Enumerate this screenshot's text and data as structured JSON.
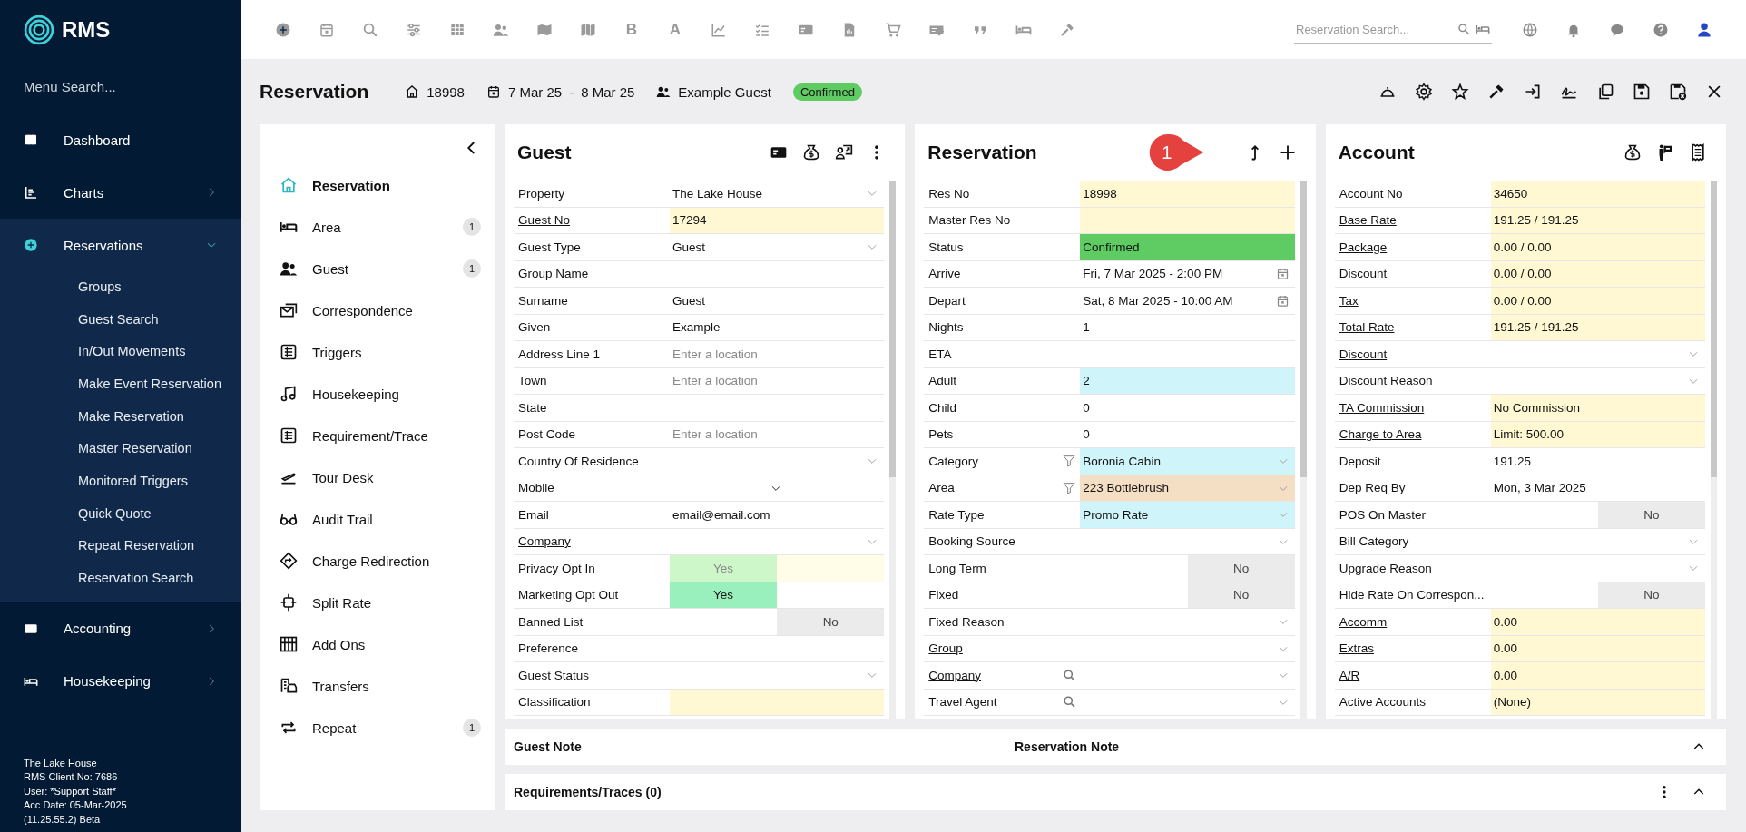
{
  "sidebar": {
    "logo": "RMS",
    "menu_search": {
      "placeholder": "Menu Search..."
    },
    "items": [
      {
        "label": "Dashboard",
        "selected": false
      },
      {
        "label": "Charts",
        "expanded": false,
        "selected": false
      },
      {
        "label": "Reservations",
        "expanded": true,
        "selected": true,
        "children": [
          {
            "label": "Groups"
          },
          {
            "label": "Guest Search"
          },
          {
            "label": "In/Out Movements"
          },
          {
            "label": "Make Event Reservation"
          },
          {
            "label": "Make Reservation"
          },
          {
            "label": "Master Reservation"
          },
          {
            "label": "Monitored Triggers"
          },
          {
            "label": "Quick Quote"
          },
          {
            "label": "Repeat Reservation"
          },
          {
            "label": "Reservation Search"
          }
        ]
      },
      {
        "label": "Accounting",
        "expanded": false,
        "selected": false
      },
      {
        "label": "Housekeeping",
        "expanded": false,
        "selected": false
      }
    ],
    "footer": [
      "The Lake House",
      "RMS Client No: 7686",
      "User: *Support Staff*",
      "Acc Date: 05-Mar-2025",
      "(11.25.55.2)  Beta"
    ]
  },
  "toolbar": {
    "letters": [
      "B",
      "A"
    ],
    "search": {
      "placeholder": "Reservation Search..."
    }
  },
  "header": {
    "title": "Reservation",
    "res_no": "18998",
    "arrive": "7 Mar 25",
    "separator": "-",
    "depart": "8 Mar 25",
    "guest": "Example Guest",
    "status": "Confirmed"
  },
  "nav": [
    {
      "label": "Reservation",
      "selected": true
    },
    {
      "label": "Area",
      "selected": false,
      "count": "1"
    },
    {
      "label": "Guest",
      "selected": false,
      "count": "1"
    },
    {
      "label": "Correspondence",
      "selected": false
    },
    {
      "label": "Triggers",
      "selected": false
    },
    {
      "label": "Housekeeping",
      "selected": false
    },
    {
      "label": "Requirement/Trace",
      "selected": false
    },
    {
      "label": "Tour Desk",
      "selected": false
    },
    {
      "label": "Audit Trail",
      "selected": false
    },
    {
      "label": "Charge Redirection",
      "selected": false
    },
    {
      "label": "Split Rate",
      "selected": false
    },
    {
      "label": "Add Ons",
      "selected": false
    },
    {
      "label": "Transfers",
      "selected": false
    },
    {
      "label": "Repeat",
      "selected": false,
      "count": "1"
    }
  ],
  "panels": [
    {
      "title": "Guest",
      "kind": "guest",
      "rows": [
        {
          "label": "Property",
          "kind": "select",
          "value": "The Lake House"
        },
        {
          "label": "Guest No",
          "link": true,
          "kind": "text",
          "value": "17294",
          "color": "#fff8d2"
        },
        {
          "label": "Guest Type",
          "kind": "select",
          "value": "Guest"
        },
        {
          "label": "Group Name",
          "kind": "text"
        },
        {
          "label": "Surname",
          "kind": "text",
          "value": "Guest"
        },
        {
          "label": "Given",
          "kind": "text",
          "value": "Example"
        },
        {
          "label": "Address Line 1",
          "kind": "text",
          "placeholder": "Enter a location"
        },
        {
          "label": "Town",
          "kind": "text",
          "placeholder": "Enter a location"
        },
        {
          "label": "State",
          "kind": "text"
        },
        {
          "label": "Post Code",
          "kind": "text",
          "placeholder": "Enter a location"
        },
        {
          "label": "Country Of Residence",
          "kind": "select"
        },
        {
          "label": "Mobile",
          "kind": "phone"
        },
        {
          "label": "Email",
          "kind": "text",
          "value": "email@email.com"
        },
        {
          "label": "Company",
          "link": true,
          "kind": "select"
        },
        {
          "label": "Privacy Opt In",
          "kind": "toggle",
          "value": "Yes",
          "on": true,
          "disabled": true
        },
        {
          "label": "Marketing Opt Out",
          "kind": "toggle",
          "value": "Yes",
          "on": true
        },
        {
          "label": "Banned List",
          "kind": "toggle",
          "value": "No",
          "on": false
        },
        {
          "label": "Preference",
          "kind": "text"
        },
        {
          "label": "Guest Status",
          "kind": "select"
        },
        {
          "label": "Classification",
          "kind": "text",
          "color": "#fff8d2"
        }
      ]
    },
    {
      "title": "Reservation",
      "kind": "reservation",
      "callout": "1",
      "rows": [
        {
          "label": "Res No",
          "kind": "text",
          "value": "18998",
          "color": "#fff8d2"
        },
        {
          "label": "Master Res No",
          "kind": "text",
          "color": "#fff8d2"
        },
        {
          "label": "Status",
          "kind": "text",
          "value": "Confirmed",
          "color": "#5fcc63"
        },
        {
          "label": "Arrive",
          "kind": "date",
          "value": "Fri, 7 Mar 2025 - 2:00 PM"
        },
        {
          "label": "Depart",
          "kind": "date",
          "value": "Sat, 8 Mar 2025 - 10:00 AM"
        },
        {
          "label": "Nights",
          "kind": "text",
          "value": "1"
        },
        {
          "label": "ETA",
          "kind": "text"
        },
        {
          "label": "Adult",
          "kind": "text",
          "value": "2",
          "color": "#cff4fa"
        },
        {
          "label": "Child",
          "kind": "text",
          "value": "0"
        },
        {
          "label": "Pets",
          "kind": "text",
          "value": "0"
        },
        {
          "label": "Category",
          "kind": "select",
          "filter_button": true,
          "value": "Boronia Cabin",
          "color": "#cff4fa"
        },
        {
          "label": "Area",
          "kind": "select",
          "filter_button": true,
          "value": "223 Bottlebrush",
          "color": "#f5dfc4"
        },
        {
          "label": "Rate Type",
          "kind": "select",
          "value": "Promo Rate",
          "color": "#cff4fa"
        },
        {
          "label": "Booking Source",
          "kind": "select"
        },
        {
          "label": "Long Term",
          "kind": "toggle",
          "value": "No",
          "on": false
        },
        {
          "label": "Fixed",
          "kind": "toggle",
          "value": "No",
          "on": false
        },
        {
          "label": "Fixed Reason",
          "kind": "select"
        },
        {
          "label": "Group",
          "link": true,
          "kind": "select"
        },
        {
          "label": "Company",
          "link": true,
          "kind": "select",
          "search_button": true
        },
        {
          "label": "Travel Agent",
          "kind": "select",
          "search_button": true
        }
      ]
    },
    {
      "title": "Account",
      "kind": "account",
      "rows": [
        {
          "label": "Account No",
          "kind": "text",
          "value": "34650",
          "color": "#fff8d2"
        },
        {
          "label": "Base Rate",
          "link": true,
          "kind": "text",
          "value": "191.25 / 191.25",
          "color": "#fff8d2"
        },
        {
          "label": "Package",
          "link": true,
          "kind": "text",
          "value": "0.00 / 0.00",
          "color": "#fff8d2"
        },
        {
          "label": "Discount",
          "kind": "text",
          "value": "0.00 / 0.00",
          "color": "#fff8d2"
        },
        {
          "label": "Tax",
          "link": true,
          "kind": "text",
          "value": "0.00 / 0.00",
          "color": "#fff8d2"
        },
        {
          "label": "Total Rate",
          "link": true,
          "kind": "text",
          "value": "191.25 / 191.25",
          "color": "#fff8d2"
        },
        {
          "label": "Discount",
          "link": true,
          "kind": "select"
        },
        {
          "label": "Discount Reason",
          "kind": "select"
        },
        {
          "label": "TA Commission",
          "link": true,
          "kind": "text",
          "value": "No Commission",
          "color": "#fff8d2"
        },
        {
          "label": "Charge to Area",
          "link": true,
          "kind": "text",
          "value": "Limit: 500.00",
          "color": "#fff8d2"
        },
        {
          "label": "Deposit",
          "kind": "text",
          "value": "191.25"
        },
        {
          "label": "Dep Req By",
          "kind": "text",
          "value": "Mon, 3 Mar 2025"
        },
        {
          "label": "POS On Master",
          "kind": "toggle",
          "value": "No",
          "on": false
        },
        {
          "label": "Bill Category",
          "kind": "select"
        },
        {
          "label": "Upgrade Reason",
          "kind": "select"
        },
        {
          "label": "Hide Rate On Correspon...",
          "kind": "toggle",
          "value": "No",
          "on": false
        },
        {
          "label": "Accomm",
          "link": true,
          "kind": "text",
          "value": "0.00",
          "color": "#fff8d2"
        },
        {
          "label": "Extras",
          "link": true,
          "kind": "text",
          "value": "0.00",
          "color": "#fff8d2"
        },
        {
          "label": "A/R",
          "link": true,
          "kind": "text",
          "value": "0.00",
          "color": "#fff8d2"
        },
        {
          "label": "Active Accounts",
          "kind": "text",
          "value": "(None)",
          "color": "#fff8d2"
        }
      ]
    }
  ],
  "notes": {
    "guest_note": "Guest Note",
    "reservation_note": "Reservation Note",
    "expanded": true
  },
  "requirements": {
    "title": "Requirements/Traces (0)",
    "expanded": true
  }
}
